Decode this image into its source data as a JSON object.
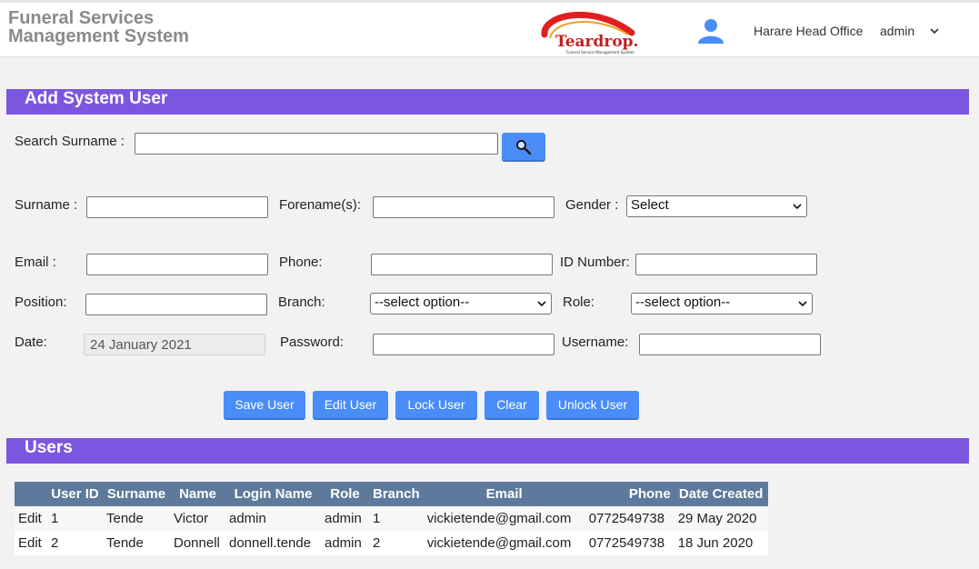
{
  "header": {
    "app_title_line1": "Funeral Services",
    "app_title_line2": "Management System",
    "logo_text": "Teardrop.",
    "logo_tagline": "Funeral Service Management System",
    "office": "Harare Head Office",
    "user": "admin",
    "colors": {
      "logo_swoosh": "#e02020",
      "logo_accent": "#f0a020",
      "user_icon": "#4a8df8"
    }
  },
  "add_section": {
    "title": "Add System User"
  },
  "search": {
    "label": "Search Surname :",
    "value": ""
  },
  "form": {
    "surname_label": "Surname :",
    "forenames_label": "Forename(s):",
    "gender_label": "Gender :",
    "gender_value": "Select",
    "email_label": "Email :",
    "phone_label": "Phone:",
    "id_label": "ID Number:",
    "position_label": "Position:",
    "branch_label": "Branch:",
    "branch_value": "--select option--",
    "role_label": "Role:",
    "role_value": "--select option--",
    "date_label": "Date:",
    "date_value": "24 January 2021",
    "password_label": "Password:",
    "username_label": "Username:"
  },
  "actions": {
    "save": "Save User",
    "edit": "Edit User",
    "lock": "Lock User",
    "clear": "Clear",
    "unlock": "Unlock User"
  },
  "users_section": {
    "title": "Users"
  },
  "table": {
    "headers": [
      "",
      "User ID",
      "Surname",
      "Name",
      "Login Name",
      "Role",
      "Branch",
      "Email",
      "Phone",
      "Date Created"
    ],
    "rows": [
      {
        "action": "Edit",
        "user_id": "1",
        "surname": "Tende",
        "name": "Victor",
        "login": "admin",
        "role": "admin",
        "branch": "1",
        "email": "vickietende@gmail.com",
        "phone": "0772549738",
        "created": "29 May 2020"
      },
      {
        "action": "Edit",
        "user_id": "2",
        "surname": "Tende",
        "name": "Donnell",
        "login": "donnell.tende",
        "role": "admin",
        "branch": "2",
        "email": "vickietende@gmail.com",
        "phone": "0772549738",
        "created": "18 Jun 2020"
      }
    ]
  },
  "colors": {
    "section_bar": "#7b57df",
    "button": "#4a8df8",
    "table_header": "#5d7a9c"
  }
}
